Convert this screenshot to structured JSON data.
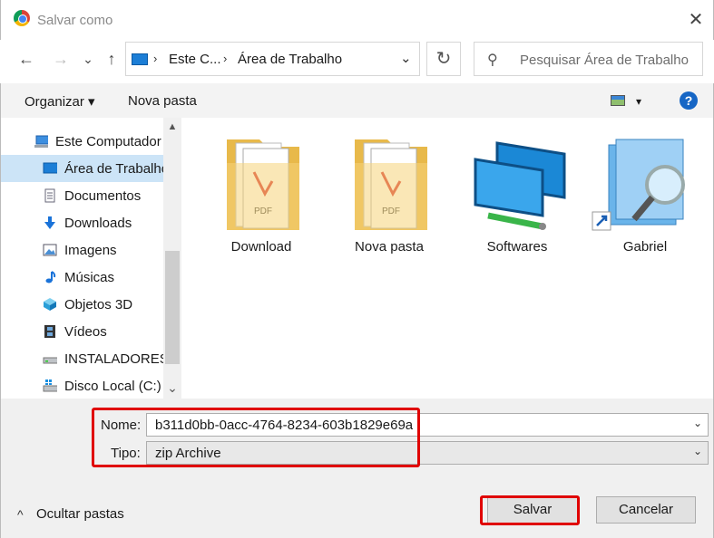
{
  "window": {
    "title": "Salvar como",
    "close_label": "✕"
  },
  "nav": {
    "back": "←",
    "forward": "→",
    "recent": "⌄",
    "up": "↑"
  },
  "address": {
    "segments": [
      "Este C...",
      "Área de Trabalho"
    ],
    "separator": "›",
    "dropdown": "⌄",
    "refresh": "↻"
  },
  "search": {
    "placeholder": "Pesquisar Área de Trabalho",
    "icon": "⚲"
  },
  "toolbar": {
    "organize": "Organizar ▾",
    "new_folder": "Nova pasta",
    "view_dropdown": "▾",
    "help": "?"
  },
  "sidebar": {
    "items": [
      {
        "label": "Este Computador",
        "icon": "computer-icon"
      },
      {
        "label": "Área de Trabalho",
        "icon": "desktop-icon",
        "selected": true
      },
      {
        "label": "Documentos",
        "icon": "documents-icon"
      },
      {
        "label": "Downloads",
        "icon": "downloads-icon"
      },
      {
        "label": "Imagens",
        "icon": "pictures-icon"
      },
      {
        "label": "Músicas",
        "icon": "music-icon"
      },
      {
        "label": "Objetos 3D",
        "icon": "objects3d-icon"
      },
      {
        "label": "Vídeos",
        "icon": "videos-icon"
      },
      {
        "label": "INSTALADORES",
        "icon": "drive-icon"
      },
      {
        "label": "Disco Local (C:)",
        "icon": "windows-drive-icon"
      }
    ],
    "scroll_up": "▲",
    "scroll_down": "⌄"
  },
  "files": [
    {
      "label": "Download",
      "icon": "pdf-folder-icon"
    },
    {
      "label": "Nova pasta",
      "icon": "pdf-folder-icon"
    },
    {
      "label": "Softwares",
      "icon": "network-monitors-icon"
    },
    {
      "label": "Gabriel",
      "icon": "search-shortcut-icon"
    }
  ],
  "form": {
    "name_label": "Nome:",
    "name_value": "b311d0bb-0acc-4764-8234-603b1829e69a",
    "type_label": "Tipo:",
    "type_value": "zip Archive",
    "chevron": "⌄"
  },
  "footer": {
    "hide_folders": "Ocultar pastas",
    "hide_icon": "^",
    "save": "Salvar",
    "cancel": "Cancelar"
  },
  "colors": {
    "highlight_red": "#e00000",
    "selection_blue": "#cce4f7",
    "help_blue": "#1666c5"
  }
}
